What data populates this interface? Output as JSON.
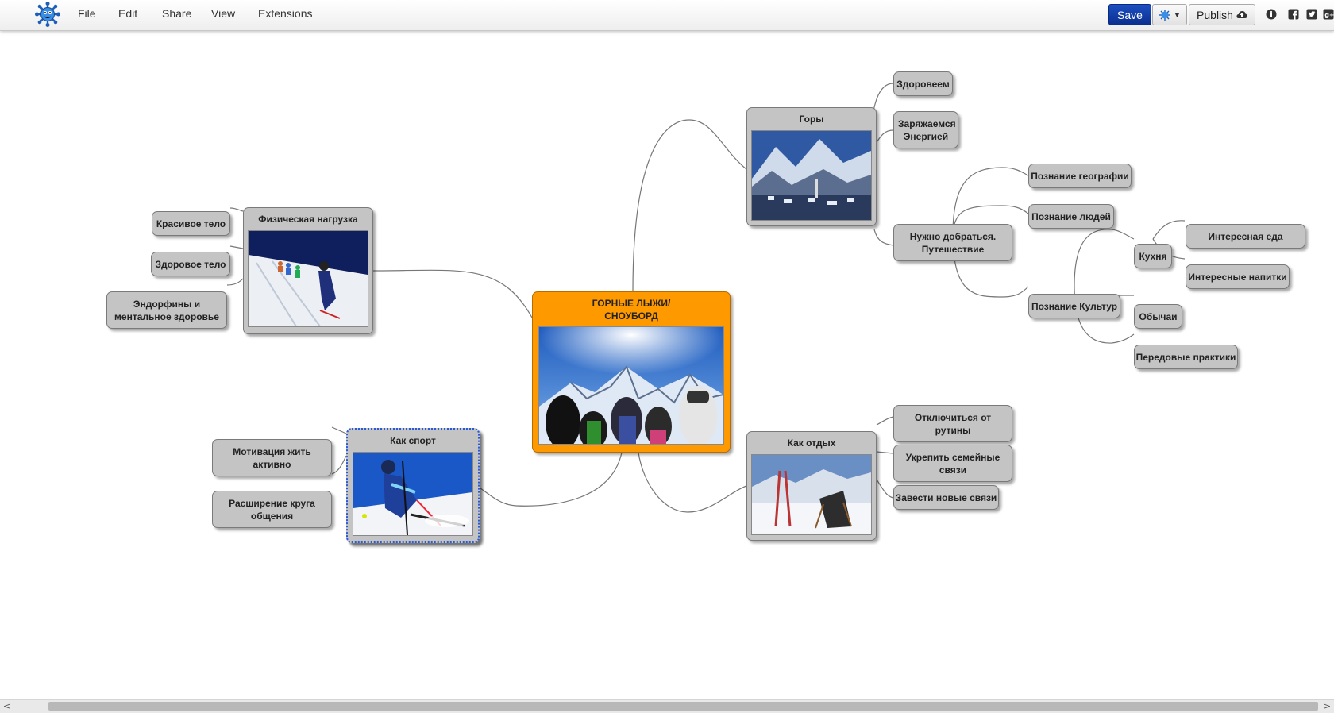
{
  "toolbar": {
    "menu": [
      "File",
      "Edit",
      "Share",
      "View",
      "Extensions"
    ],
    "save_label": "Save",
    "publish_label": "Publish",
    "brand_color": "#0b2f8f"
  },
  "mindmap": {
    "central": "ГОРНЫЕ ЛЫЖИ/ СНОУБОРД",
    "gory": "Горы",
    "zdoroveem": "Здоровеем",
    "zaryazhaemsya": "Заряжаемся Энергией",
    "nuzhno": "Нужно добраться. Путешествие",
    "geografia": "Познание географии",
    "lyudey": "Познание людей",
    "kultur": "Познание Культур",
    "kuhnya": "Кухня",
    "eda": "Интересная еда",
    "napitki": "Интересные напитки",
    "obychai": "Обычаи",
    "praktiki": "Передовые практики",
    "fiz": "Физическая нагрузка",
    "krasivoe": "Красивое тело",
    "zdorovoe": "Здоровое тело",
    "endorfiny": "Эндорфины и ментальное здоровье",
    "sport": "Как спорт",
    "motivaciya": "Мотивация жить активно",
    "rasshirenie": "Расширение круга общения",
    "otdyh": "Как отдых",
    "otklyuchitsya": "Отключиться от рутины",
    "ukrepit": "Укрепить семейные связи",
    "zavesti": "Завести новые связи"
  },
  "colors": {
    "central": "#ff9900",
    "node": "#c4c4c4",
    "link": "#777777",
    "selection": "#2a5bd7"
  }
}
